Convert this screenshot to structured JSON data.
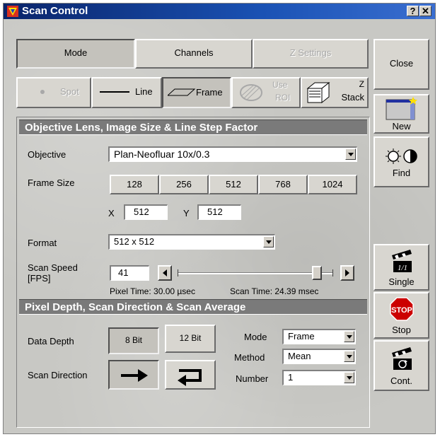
{
  "window": {
    "title": "Scan Control",
    "help_btn": "?",
    "close_btn": "✕"
  },
  "tabs": [
    {
      "label": "Mode",
      "state": "pressed"
    },
    {
      "label": "Channels",
      "state": "normal"
    },
    {
      "label": "Z Settings",
      "state": "disabled"
    }
  ],
  "modes": {
    "spot": "Spot",
    "line": "Line",
    "frame": "Frame",
    "use_roi_1": "Use",
    "use_roi_2": "ROI",
    "zstack_1": "Z",
    "zstack_2": "Stack"
  },
  "sidebar": {
    "close": "Close",
    "new": "New",
    "find": "Find",
    "single": "Single",
    "stop_sign": "STOP",
    "stop": "Stop",
    "cont": "Cont."
  },
  "section1": {
    "header": "Objective Lens, Image Size & Line Step Factor",
    "objective_label": "Objective",
    "objective_value": "Plan-Neofluar 10x/0.3",
    "frame_size_label": "Frame Size",
    "frame_sizes": [
      "128",
      "256",
      "512",
      "768",
      "1024"
    ],
    "x_label": "X",
    "x_value": "512",
    "y_label": "Y",
    "y_value": "512",
    "format_label": "Format",
    "format_value": "512 x 512",
    "scan_speed_label_1": "Scan Speed",
    "scan_speed_label_2": "[FPS]",
    "scan_speed_value": "41",
    "scan_speed_slider_fraction": 0.92,
    "pixel_time": "Pixel Time:  30.00 µsec",
    "scan_time": "Scan Time:  24.39 msec"
  },
  "section2": {
    "header": "Pixel Depth, Scan Direction & Scan Average",
    "data_depth_label": "Data Depth",
    "bit8": "8 Bit",
    "bit12": "12 Bit",
    "scan_direction_label": "Scan Direction",
    "mode_label": "Mode",
    "mode_value": "Frame",
    "method_label": "Method",
    "method_value": "Mean",
    "number_label": "Number",
    "number_value": "1"
  },
  "colors": {
    "title_bar": "#0a246a",
    "section_header": "#7a7a7a",
    "stop_red": "#cc0000"
  }
}
